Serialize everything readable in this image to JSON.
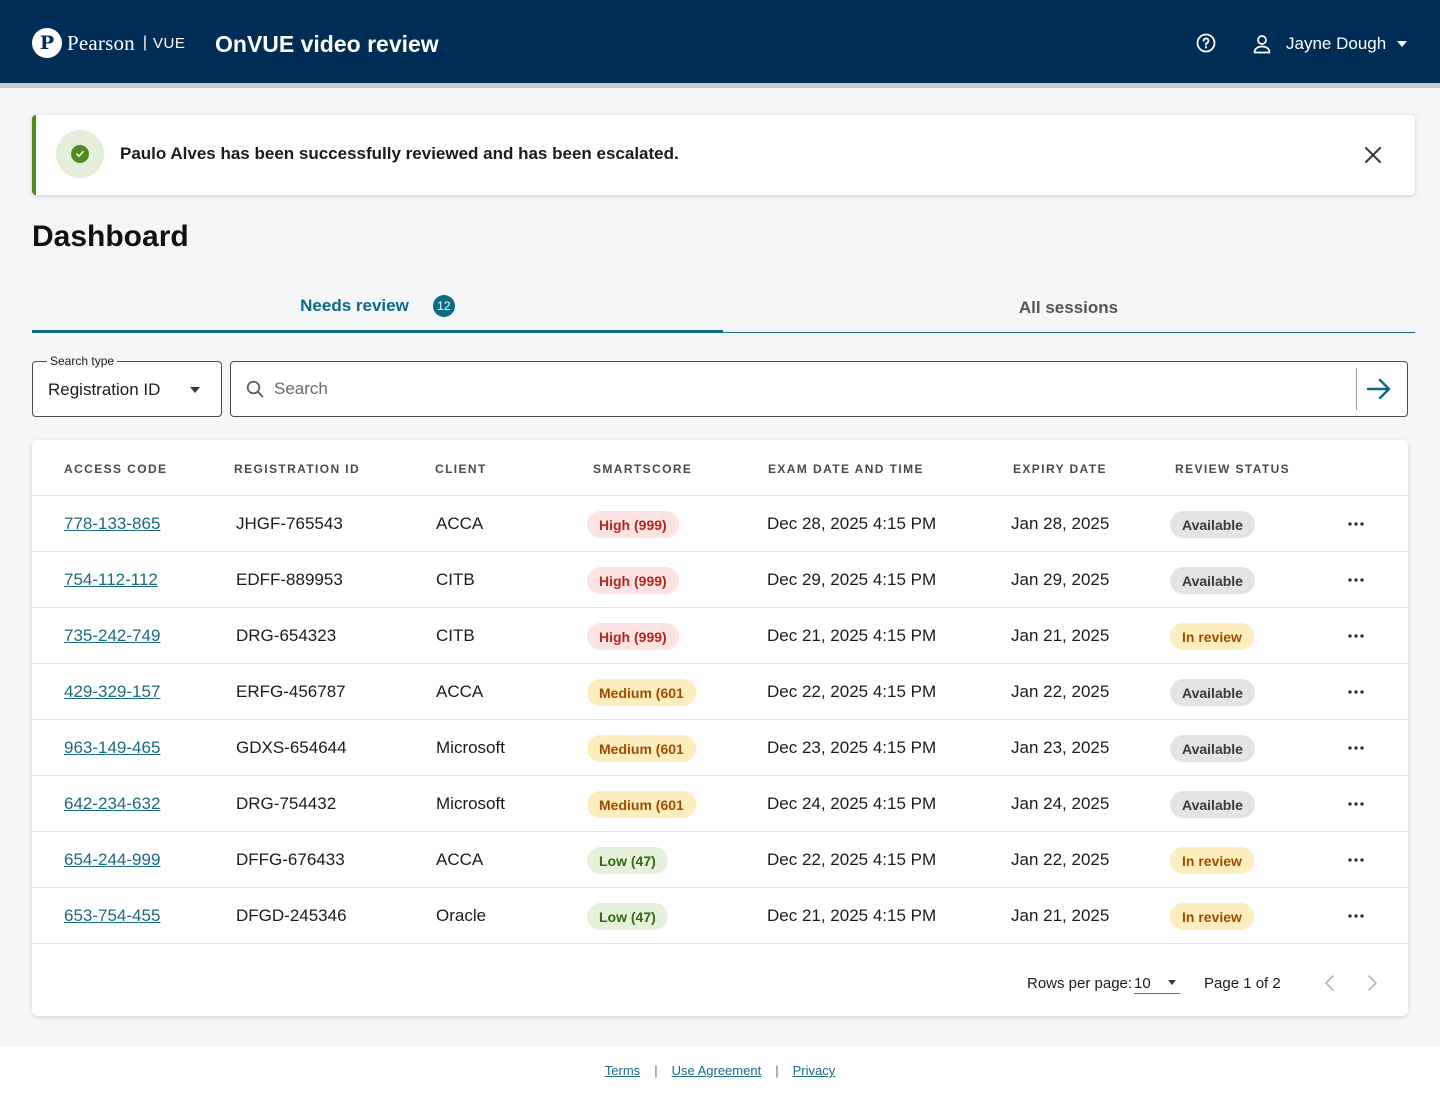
{
  "header": {
    "logo_word": "Pearson",
    "logo_sep": "|",
    "logo_vue": "VUE",
    "logo_glyph": "P",
    "app_title": "OnVUE video review",
    "user_name": "Jayne Dough"
  },
  "toast": {
    "message": "Paulo Alves has been successfully reviewed and has been escalated."
  },
  "page": {
    "title": "Dashboard"
  },
  "tabs": [
    {
      "label": "Needs review",
      "badge": "12",
      "active": true
    },
    {
      "label": "All sessions",
      "active": false
    }
  ],
  "search": {
    "type_label": "Search type",
    "type_value": "Registration ID",
    "placeholder": "Search"
  },
  "table": {
    "headers": [
      "ACCESS CODE",
      "REGISTRATION ID",
      "CLIENT",
      "SMARTSCORE",
      "EXAM DATE AND TIME",
      "EXPIRY DATE",
      "REVIEW STATUS"
    ],
    "rows": [
      {
        "access_code": "778-133-865",
        "registration_id": "JHGF-765543",
        "client": "ACCA",
        "smartscore": "High (999)",
        "score_level": "high",
        "exam_datetime": "Dec 28, 2025 4:15 PM",
        "expiry_date": "Jan 28, 2025",
        "status": "Available",
        "status_level": "available"
      },
      {
        "access_code": "754-112-112",
        "registration_id": "EDFF-889953",
        "client": "CITB",
        "smartscore": "High (999)",
        "score_level": "high",
        "exam_datetime": "Dec 29, 2025 4:15 PM",
        "expiry_date": "Jan 29, 2025",
        "status": "Available",
        "status_level": "available"
      },
      {
        "access_code": "735-242-749",
        "registration_id": "DRG-654323",
        "client": "CITB",
        "smartscore": "High (999)",
        "score_level": "high",
        "exam_datetime": "Dec 21, 2025 4:15 PM",
        "expiry_date": "Jan 21, 2025",
        "status": "In review",
        "status_level": "inreview"
      },
      {
        "access_code": "429-329-157",
        "registration_id": "ERFG-456787",
        "client": "ACCA",
        "smartscore": "Medium (601",
        "score_level": "medium",
        "exam_datetime": "Dec 22, 2025 4:15 PM",
        "expiry_date": "Jan 22, 2025",
        "status": "Available",
        "status_level": "available"
      },
      {
        "access_code": "963-149-465",
        "registration_id": "GDXS-654644",
        "client": "Microsoft",
        "smartscore": "Medium (601",
        "score_level": "medium",
        "exam_datetime": "Dec 23, 2025 4:15 PM",
        "expiry_date": "Jan 23, 2025",
        "status": "Available",
        "status_level": "available"
      },
      {
        "access_code": "642-234-632",
        "registration_id": "DRG-754432",
        "client": "Microsoft",
        "smartscore": "Medium (601",
        "score_level": "medium",
        "exam_datetime": "Dec 24, 2025 4:15 PM",
        "expiry_date": "Jan 24, 2025",
        "status": "Available",
        "status_level": "available"
      },
      {
        "access_code": "654-244-999",
        "registration_id": "DFFG-676433",
        "client": "ACCA",
        "smartscore": "Low (47)",
        "score_level": "low",
        "exam_datetime": "Dec 22, 2025 4:15 PM",
        "expiry_date": "Jan 22, 2025",
        "status": "In review",
        "status_level": "inreview"
      },
      {
        "access_code": "653-754-455",
        "registration_id": "DFGD-245346",
        "client": "Oracle",
        "smartscore": "Low (47)",
        "score_level": "low",
        "exam_datetime": "Dec 21, 2025 4:15 PM",
        "expiry_date": "Jan 21, 2025",
        "status": "In review",
        "status_level": "inreview"
      }
    ]
  },
  "pagination": {
    "rows_per_page_label": "Rows per page:",
    "rows_per_page_value": "10",
    "page_info": "Page 1 of 2"
  },
  "footer": {
    "links": [
      "Terms",
      "Use Agreement",
      "Privacy"
    ],
    "separator": "|"
  },
  "icons": {
    "help": "help-circle-icon",
    "user": "user-icon",
    "success": "check-circle-icon",
    "close": "close-icon",
    "search": "search-icon",
    "submit": "arrow-right-icon",
    "more": "more-horizontal-icon"
  },
  "colors": {
    "header_bg": "#002d55",
    "accent": "#0b6a86",
    "success": "#4d8b1b",
    "high_bg": "#fce4e4",
    "high_text": "#b3261e",
    "medium_bg": "#feedbd",
    "medium_text": "#a14a00",
    "low_bg": "#e6f1dc",
    "low_text": "#2e6a14",
    "available_bg": "#e2e3e5"
  }
}
